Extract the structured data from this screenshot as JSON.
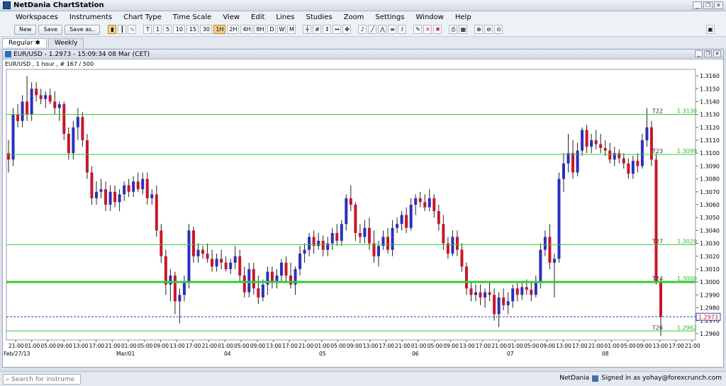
{
  "app": {
    "title": "NetDania ChartStation"
  },
  "menu": [
    "Workspaces",
    "Instruments",
    "Chart Type",
    "Time Scale",
    "View",
    "Edit",
    "Lines",
    "Studies",
    "Zoom",
    "Settings",
    "Window",
    "Help"
  ],
  "toolbar": {
    "new_label": "New",
    "save_label": "Save",
    "saveas_label": "Save as..",
    "timescales": [
      "T",
      "1",
      "5",
      "10",
      "15",
      "30",
      "1H",
      "2H",
      "4H",
      "8H",
      "D",
      "W",
      "M"
    ]
  },
  "tabs": [
    {
      "label": "Regular",
      "pin": "✱"
    },
    {
      "label": "Weekly"
    }
  ],
  "chart_window": {
    "title": "EUR/USD - 1.2973 - 15:09:34  08 Mar (CET)",
    "subtitle": "EUR/USD , 1 hour , # 167 / 500"
  },
  "chart_data": {
    "type": "candlestick",
    "symbol": "EUR/USD",
    "ylim": [
      1.2955,
      1.3165
    ],
    "y_ticks": [
      "1.3160",
      "1.3150",
      "1.3140",
      "1.3130",
      "1.3120",
      "1.3110",
      "1.3100",
      "1.3090",
      "1.3080",
      "1.3070",
      "1.3060",
      "1.3050",
      "1.3040",
      "1.3030",
      "1.3020",
      "1.3010",
      "1.3000",
      "1.2990",
      "1.2980",
      "1.2970",
      "1.2960"
    ],
    "x_hour_labels": [
      "21:00",
      "01:00",
      "05:00",
      "09:00",
      "13:00",
      "17:00",
      "21:00",
      "01:00",
      "05:00",
      "09:00",
      "13:00",
      "17:00",
      "21:00",
      "01:00",
      "05:00",
      "09:00",
      "13:00",
      "17:00",
      "21:00",
      "01:00",
      "05:00",
      "09:00",
      "13:00",
      "17:00",
      "21:00",
      "01:00",
      "05:00",
      "09:00",
      "13:00",
      "17:00",
      "21:00",
      "01:00",
      "05:00",
      "09:00",
      "13:00",
      "17:00",
      "21:00",
      "01:00",
      "05:00",
      "09:00",
      "13:00",
      "17:00",
      "21:00"
    ],
    "x_date_labels": [
      "Feb/27/13",
      "Mar/01",
      "04",
      "05",
      "06",
      "07",
      "08"
    ],
    "up_color": "#2b2fbf",
    "down_color": "#c8162a",
    "level_color": "#33cc33",
    "h_lines": [
      {
        "name": "T22",
        "value": 1.313,
        "label": "1.3130",
        "width": 1
      },
      {
        "name": "T23",
        "value": 1.3099,
        "label": "1.3099",
        "width": 1
      },
      {
        "name": "T27",
        "value": 1.3029,
        "label": "1.3029",
        "width": 1
      },
      {
        "name": "T24",
        "value": 1.3,
        "label": "1.3000",
        "width": 3
      },
      {
        "name": "T26",
        "value": 1.2962,
        "label": "1.2962",
        "width": 1
      }
    ],
    "last_price": {
      "value": 1.2973,
      "label": "1.2973"
    },
    "candles": [
      [
        1.31,
        1.311,
        1.3085,
        1.3095
      ],
      [
        1.3095,
        1.3135,
        1.309,
        1.313
      ],
      [
        1.313,
        1.3138,
        1.312,
        1.3125
      ],
      [
        1.3125,
        1.3145,
        1.312,
        1.314
      ],
      [
        1.314,
        1.316,
        1.3125,
        1.313
      ],
      [
        1.313,
        1.3155,
        1.3125,
        1.315
      ],
      [
        1.315,
        1.3155,
        1.314,
        1.3145
      ],
      [
        1.3145,
        1.315,
        1.3138,
        1.3142
      ],
      [
        1.3142,
        1.3148,
        1.3135,
        1.3145
      ],
      [
        1.3145,
        1.315,
        1.3138,
        1.314
      ],
      [
        1.314,
        1.3148,
        1.313,
        1.3135
      ],
      [
        1.3135,
        1.314,
        1.3125,
        1.3138
      ],
      [
        1.3138,
        1.314,
        1.311,
        1.3115
      ],
      [
        1.3115,
        1.312,
        1.3095,
        1.31
      ],
      [
        1.31,
        1.3125,
        1.3095,
        1.312
      ],
      [
        1.312,
        1.3135,
        1.311,
        1.3128
      ],
      [
        1.3128,
        1.3132,
        1.3105,
        1.311
      ],
      [
        1.311,
        1.3115,
        1.308,
        1.3085
      ],
      [
        1.3085,
        1.309,
        1.306,
        1.3065
      ],
      [
        1.3065,
        1.3078,
        1.306,
        1.307
      ],
      [
        1.307,
        1.308,
        1.3065,
        1.3072
      ],
      [
        1.3072,
        1.3078,
        1.3055,
        1.306
      ],
      [
        1.306,
        1.3075,
        1.3055,
        1.307
      ],
      [
        1.307,
        1.3075,
        1.3058,
        1.3062
      ],
      [
        1.3062,
        1.3072,
        1.3055,
        1.3068
      ],
      [
        1.3068,
        1.3078,
        1.3063,
        1.3075
      ],
      [
        1.3075,
        1.308,
        1.3066,
        1.307
      ],
      [
        1.307,
        1.3082,
        1.3066,
        1.3078
      ],
      [
        1.3078,
        1.3085,
        1.307,
        1.3072
      ],
      [
        1.3072,
        1.3085,
        1.3068,
        1.308
      ],
      [
        1.308,
        1.3085,
        1.306,
        1.3065
      ],
      [
        1.3065,
        1.3072,
        1.306,
        1.3068
      ],
      [
        1.3068,
        1.3075,
        1.3035,
        1.304
      ],
      [
        1.304,
        1.3045,
        1.3015,
        1.302
      ],
      [
        1.302,
        1.3025,
        1.299,
        1.2998
      ],
      [
        1.2998,
        1.301,
        1.2985,
        1.3005
      ],
      [
        1.3005,
        1.3008,
        1.2975,
        1.2985
      ],
      [
        1.2985,
        1.2995,
        1.2968,
        1.299
      ],
      [
        1.299,
        1.3005,
        1.2985,
        1.3
      ],
      [
        1.3,
        1.3045,
        1.2995,
        1.304
      ],
      [
        1.304,
        1.3043,
        1.3015,
        1.302
      ],
      [
        1.302,
        1.303,
        1.3015,
        1.3025
      ],
      [
        1.3025,
        1.3028,
        1.3018,
        1.3022
      ],
      [
        1.3022,
        1.303,
        1.3015,
        1.3018
      ],
      [
        1.3018,
        1.3025,
        1.3008,
        1.3012
      ],
      [
        1.3012,
        1.3022,
        1.3008,
        1.3018
      ],
      [
        1.3018,
        1.3025,
        1.301,
        1.3015
      ],
      [
        1.3015,
        1.302,
        1.3008,
        1.301
      ],
      [
        1.301,
        1.3018,
        1.3006,
        1.3015
      ],
      [
        1.3015,
        1.3028,
        1.301,
        1.302
      ],
      [
        1.302,
        1.3025,
        1.3,
        1.3005
      ],
      [
        1.3005,
        1.3012,
        1.2988,
        1.2992
      ],
      [
        1.2992,
        1.3015,
        1.2988,
        1.301
      ],
      [
        1.301,
        1.3015,
        1.299,
        1.2995
      ],
      [
        1.2995,
        1.3005,
        1.2983,
        1.2988
      ],
      [
        1.2988,
        1.3002,
        1.2985,
        1.2998
      ],
      [
        1.2998,
        1.3012,
        1.299,
        1.3008
      ],
      [
        1.3008,
        1.3012,
        1.2995,
        1.3
      ],
      [
        1.3,
        1.301,
        1.2995,
        1.3005
      ],
      [
        1.3005,
        1.3018,
        1.3,
        1.3015
      ],
      [
        1.3015,
        1.302,
        1.3,
        1.3005
      ],
      [
        1.3005,
        1.3015,
        1.2995,
        1.2998
      ],
      [
        1.2998,
        1.3012,
        1.299,
        1.301
      ],
      [
        1.301,
        1.3028,
        1.3005,
        1.3022
      ],
      [
        1.3022,
        1.303,
        1.3015,
        1.3025
      ],
      [
        1.3025,
        1.3038,
        1.302,
        1.3035
      ],
      [
        1.3035,
        1.304,
        1.3022,
        1.3028
      ],
      [
        1.3028,
        1.3038,
        1.3025,
        1.3032
      ],
      [
        1.3032,
        1.3036,
        1.302,
        1.3025
      ],
      [
        1.3025,
        1.3035,
        1.302,
        1.303
      ],
      [
        1.303,
        1.3042,
        1.3025,
        1.3038
      ],
      [
        1.3038,
        1.3045,
        1.3028,
        1.3032
      ],
      [
        1.3032,
        1.3048,
        1.3028,
        1.3045
      ],
      [
        1.3045,
        1.3068,
        1.304,
        1.3065
      ],
      [
        1.3065,
        1.3075,
        1.3055,
        1.306
      ],
      [
        1.306,
        1.3062,
        1.3032,
        1.3038
      ],
      [
        1.3038,
        1.3045,
        1.303,
        1.3035
      ],
      [
        1.3035,
        1.3048,
        1.303,
        1.3042
      ],
      [
        1.3042,
        1.305,
        1.3025,
        1.303
      ],
      [
        1.303,
        1.304,
        1.3015,
        1.302
      ],
      [
        1.302,
        1.3032,
        1.3012,
        1.3028
      ],
      [
        1.3028,
        1.304,
        1.3025,
        1.3035
      ],
      [
        1.3035,
        1.3042,
        1.3022,
        1.3025
      ],
      [
        1.3025,
        1.3048,
        1.302,
        1.3042
      ],
      [
        1.3042,
        1.305,
        1.3038,
        1.3045
      ],
      [
        1.3045,
        1.3055,
        1.304,
        1.3052
      ],
      [
        1.3052,
        1.3058,
        1.3038,
        1.3042
      ],
      [
        1.3042,
        1.3065,
        1.304,
        1.306
      ],
      [
        1.306,
        1.3068,
        1.3052,
        1.3065
      ],
      [
        1.3065,
        1.307,
        1.3058,
        1.3062
      ],
      [
        1.3062,
        1.3068,
        1.3055,
        1.3058
      ],
      [
        1.3058,
        1.3072,
        1.3055,
        1.3065
      ],
      [
        1.3065,
        1.3068,
        1.305,
        1.3055
      ],
      [
        1.3055,
        1.306,
        1.304,
        1.3045
      ],
      [
        1.3045,
        1.3052,
        1.3025,
        1.303
      ],
      [
        1.303,
        1.3035,
        1.3018,
        1.3022
      ],
      [
        1.3022,
        1.304,
        1.302,
        1.3035
      ],
      [
        1.3035,
        1.304,
        1.302,
        1.3025
      ],
      [
        1.3025,
        1.303,
        1.3008,
        1.3012
      ],
      [
        1.3012,
        1.3015,
        1.299,
        1.2995
      ],
      [
        1.2995,
        1.3,
        1.2985,
        1.299
      ],
      [
        1.299,
        1.2998,
        1.2985,
        1.2992
      ],
      [
        1.2992,
        1.2998,
        1.2982,
        1.2988
      ],
      [
        1.2988,
        1.2995,
        1.298,
        1.2992
      ],
      [
        1.2992,
        1.3,
        1.2985,
        1.299
      ],
      [
        1.299,
        1.2995,
        1.297,
        1.2975
      ],
      [
        1.2975,
        1.2992,
        1.2965,
        1.2988
      ],
      [
        1.2988,
        1.2995,
        1.2978,
        1.2982
      ],
      [
        1.2982,
        1.2992,
        1.2975,
        1.2985
      ],
      [
        1.2985,
        1.2998,
        1.298,
        1.2995
      ],
      [
        1.2995,
        1.3,
        1.2985,
        1.299
      ],
      [
        1.299,
        1.3,
        1.2986,
        1.2996
      ],
      [
        1.2996,
        1.3002,
        1.299,
        1.2994
      ],
      [
        1.2994,
        1.3,
        1.2985,
        1.299
      ],
      [
        1.299,
        1.3005,
        1.2988,
        1.3
      ],
      [
        1.3,
        1.303,
        1.2995,
        1.3025
      ],
      [
        1.3025,
        1.304,
        1.302,
        1.3035
      ],
      [
        1.3035,
        1.3045,
        1.301,
        1.3015
      ],
      [
        1.3015,
        1.3022,
        1.2988,
        1.3018
      ],
      [
        1.3018,
        1.3085,
        1.3015,
        1.308
      ],
      [
        1.308,
        1.31,
        1.307,
        1.3092
      ],
      [
        1.3092,
        1.3115,
        1.3085,
        1.31
      ],
      [
        1.31,
        1.311,
        1.308,
        1.3085
      ],
      [
        1.3085,
        1.3108,
        1.3082,
        1.3102
      ],
      [
        1.3102,
        1.312,
        1.3098,
        1.3118
      ],
      [
        1.3118,
        1.3122,
        1.31,
        1.3105
      ],
      [
        1.3105,
        1.3115,
        1.31,
        1.311
      ],
      [
        1.311,
        1.3118,
        1.3103,
        1.3107
      ],
      [
        1.3107,
        1.3115,
        1.31,
        1.3104
      ],
      [
        1.3104,
        1.311,
        1.3098,
        1.3102
      ],
      [
        1.3102,
        1.3108,
        1.3092,
        1.3095
      ],
      [
        1.3095,
        1.3105,
        1.309,
        1.31
      ],
      [
        1.31,
        1.3103,
        1.3092,
        1.3096
      ],
      [
        1.3096,
        1.31,
        1.3088,
        1.3092
      ],
      [
        1.3092,
        1.3096,
        1.308,
        1.3084
      ],
      [
        1.3084,
        1.3098,
        1.308,
        1.3094
      ],
      [
        1.3094,
        1.31,
        1.3085,
        1.309
      ],
      [
        1.309,
        1.3115,
        1.3088,
        1.311
      ],
      [
        1.311,
        1.3135,
        1.3105,
        1.312
      ],
      [
        1.312,
        1.3125,
        1.309,
        1.3095
      ],
      [
        1.3095,
        1.31,
        1.2998,
        1.3
      ],
      [
        1.3,
        1.3002,
        1.2958,
        1.2973
      ]
    ]
  },
  "status": {
    "search_placeholder": "Search for instrument",
    "brand": "NetDania",
    "signed_in": "Signed in as yohay@forexcrunch.com"
  }
}
